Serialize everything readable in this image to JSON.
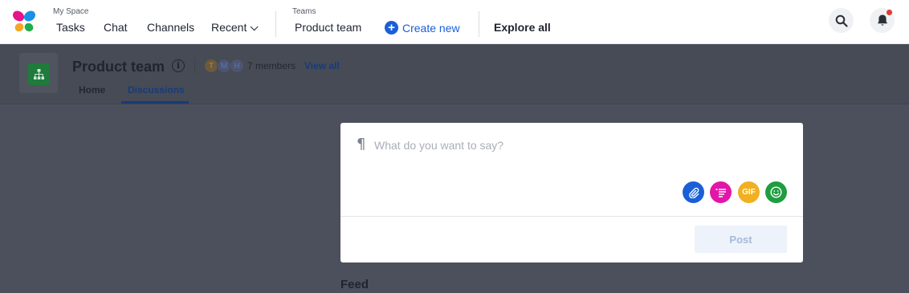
{
  "nav": {
    "my_space_caption": "My Space",
    "tasks": "Tasks",
    "chat": "Chat",
    "channels": "Channels",
    "recent": "Recent",
    "teams_caption": "Teams",
    "product_team": "Product team",
    "create_new": "Create new",
    "explore_all": "Explore all",
    "icons": [
      "butterfly-logo",
      "chevron-down-icon",
      "plus-icon",
      "search-icon",
      "bell-icon"
    ],
    "accent_color": "#1a5fd8",
    "notification_dot_color": "#e23a2e"
  },
  "team": {
    "name": "Product team",
    "member_initials": [
      "T",
      "M",
      "H"
    ],
    "members_count": "7 members",
    "view_all": "View all",
    "tabs": [
      {
        "label": "Home",
        "active": false
      },
      {
        "label": "Discussions",
        "active": true
      }
    ],
    "avatar_color": "#1f7a3c"
  },
  "composer": {
    "placeholder": "What do you want to say?",
    "gif_label": "GIF",
    "post_label": "Post",
    "tool_icons": [
      "paperclip-icon",
      "list-icon",
      "gif-icon",
      "emoji-icon"
    ],
    "tool_colors": [
      "#1a5fd8",
      "#e216a8",
      "#f0b020",
      "#1f9d40"
    ]
  },
  "feed": {
    "label": "Feed"
  }
}
